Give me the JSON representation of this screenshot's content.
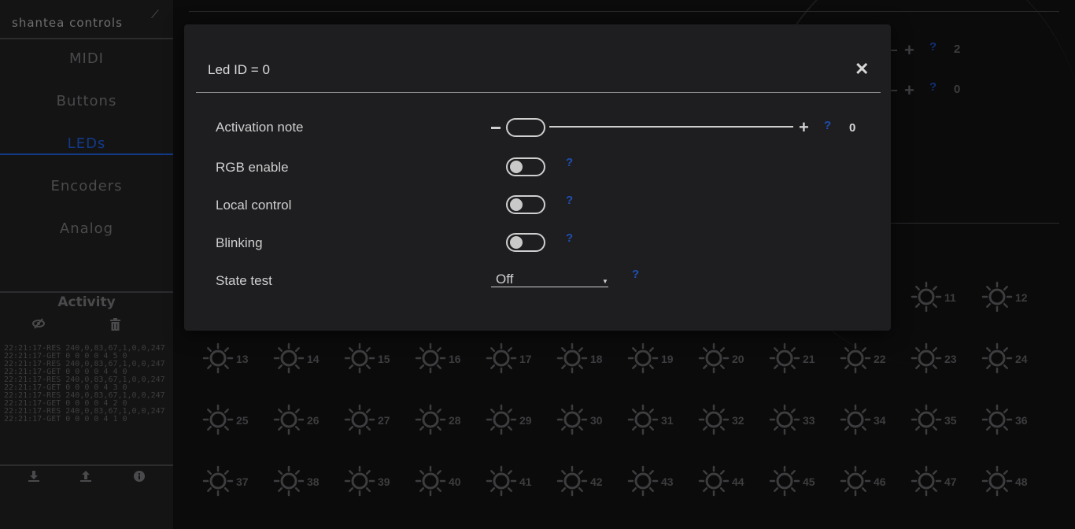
{
  "brand": {
    "name": "shantea controls"
  },
  "sidebar": {
    "items": [
      {
        "label": "MIDI"
      },
      {
        "label": "Buttons"
      },
      {
        "label": "LEDs"
      },
      {
        "label": "Encoders"
      },
      {
        "label": "Analog"
      }
    ],
    "active": "LEDs"
  },
  "activity": {
    "title": "Activity",
    "log": [
      "22:21:17-RES 240,0,83,67,1,0,0,247",
      "22:21:17-GET 0 0 0 0 4 5 0",
      "22:21:17-RES 240,0,83,67,1,0,0,247",
      "22:21:17-GET 0 0 0 0 4 4 0",
      "22:21:17-RES 240,0,83,67,1,0,0,247",
      "22:21:17-GET 0 0 0 0 4 3 0",
      "22:21:17-RES 240,0,83,67,1,0,0,247",
      "22:21:17-GET 0 0 0 0 4 2 0",
      "22:21:17-RES 240,0,83,67,1,0,0,247",
      "22:21:17-GET 0 0 0 0 4 1 0"
    ]
  },
  "background": {
    "settings_values": [
      "2",
      "0"
    ],
    "help_mark": "?",
    "leds": [
      "11",
      "12",
      "13",
      "14",
      "15",
      "16",
      "17",
      "18",
      "19",
      "20",
      "21",
      "22",
      "23",
      "24",
      "25",
      "26",
      "27",
      "28",
      "29",
      "30",
      "31",
      "32",
      "33",
      "34",
      "35",
      "36",
      "37",
      "38",
      "39",
      "40",
      "41",
      "42",
      "43",
      "44",
      "45",
      "46",
      "47",
      "48"
    ]
  },
  "modal": {
    "title": "Led ID = 0",
    "close": "✕",
    "activation_note": {
      "label": "Activation note",
      "value": "0",
      "minus": "−",
      "plus": "+"
    },
    "rgb_enable": {
      "label": "RGB enable",
      "on": false
    },
    "local_control": {
      "label": "Local control",
      "on": false
    },
    "blinking": {
      "label": "Blinking",
      "on": false
    },
    "state_test": {
      "label": "State test",
      "selected": "Off"
    },
    "help": "?"
  },
  "colors": {
    "accent": "#123a8a",
    "help": "#1f4fb0",
    "modal_bg": "#1e1e21",
    "page_bg": "#0b0b0c"
  }
}
